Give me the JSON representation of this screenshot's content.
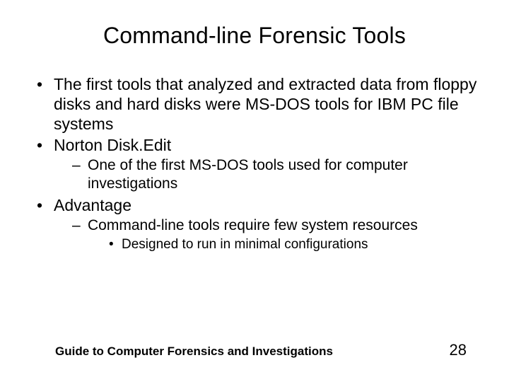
{
  "title": "Command-line Forensic Tools",
  "bullets": {
    "b0": "The first tools that analyzed and extracted data from floppy disks and hard disks were MS-DOS tools for IBM PC file systems",
    "b1": "Norton Disk.Edit",
    "b1_0": "One of the first MS-DOS tools used for computer investigations",
    "b2": "Advantage",
    "b2_0": "Command-line tools require few system resources",
    "b2_0_0": "Designed to run in minimal configurations"
  },
  "footer": {
    "left": "Guide to Computer Forensics and Investigations",
    "right": "28"
  }
}
